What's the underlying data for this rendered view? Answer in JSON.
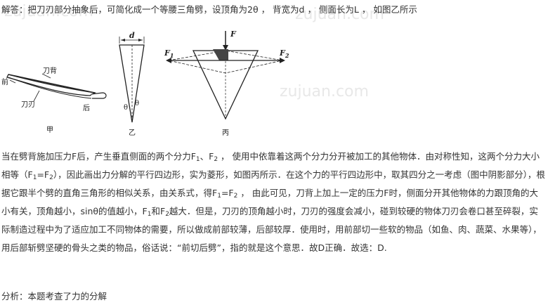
{
  "solution": {
    "first_line": "解答：把刀刃部分抽象后，可简化成一个等腰三角劈，设顶角为2θ ， 背宽为d ， 侧面长为L ， 如图乙所示",
    "para": {
      "s1": "当在劈背施加压力F后，产生垂直侧面的两个分力F",
      "s2": "、F",
      "s3": " ， 使用中依靠着这两个分力分开被加工的其他物体．由对称性知，这两个分力大小相等（F",
      "s4": "=F",
      "s5": "），因此画出力分解的平行四边形，实为菱形，如图丙所示．在这个力的平行四边形中，取其四分之一考虑（图中阴影部分），根据它跟半个劈的直角三角形的相似关系，由关系式，得F",
      "s6": "=F",
      "s7": " ， 由此可见，刀背上加上一定的压力F时，侧面分开其他物体的力跟顶角的大小有关，顶角越小，sinθ的值越小，F",
      "s8": "和F",
      "s9": "越大．但是，刀刃的顶角越小时，刀刃的强度会减小，碰到较硬的物体刀刃会卷口甚至碎裂，实际制造过程中为了适应加工不同物体的需要，所以做成前部较薄，后部较厚．使用时，用前部切一些软的物品（如鱼、肉、蔬菜、水果等），用后部斩劈坚硬的骨头之类的物品，俗话说：“前切后劈”，指的就是这个意思．故D正确．故选：D.",
      "sub1": "1",
      "sub2": "2"
    },
    "analysis": "分析：本题考查了力的分解"
  },
  "figures": {
    "jia": {
      "caption": "甲",
      "back": "刀背",
      "front": "前",
      "edge": "刀刃",
      "rear": "后"
    },
    "yi": {
      "caption": "乙",
      "d": "d",
      "theta_left": "θ",
      "theta_right": "θ"
    },
    "bing": {
      "caption": "丙",
      "F": "F",
      "F1": "F",
      "F2": "F",
      "sub1": "1",
      "sub2": "2"
    }
  },
  "watermark": {
    "text": "zujuan.com"
  }
}
